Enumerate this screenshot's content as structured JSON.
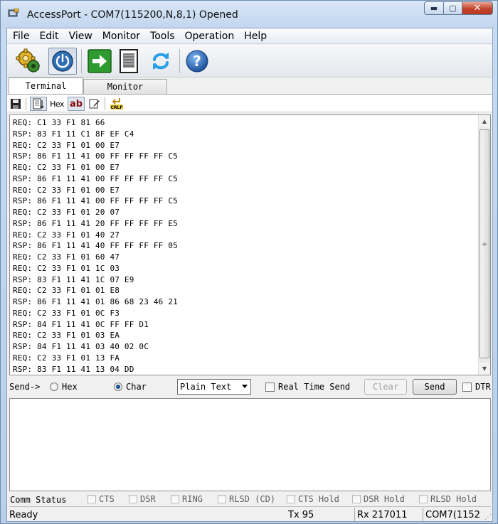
{
  "window": {
    "title": "AccessPort - COM7(115200,N,8,1) Opened",
    "minimize_glyph": "▬",
    "maximize_glyph": "▢",
    "close_glyph": "✕"
  },
  "menu": [
    "File",
    "Edit",
    "View",
    "Monitor",
    "Tools",
    "Operation",
    "Help"
  ],
  "toolbar": {
    "buttons": [
      "settings-gears-icon",
      "power-icon",
      "go-arrow-icon",
      "document-icon",
      "refresh-icon",
      "help-icon"
    ],
    "help_glyph": "?"
  },
  "tabs": {
    "active": "Terminal",
    "inactive": "Monitor"
  },
  "small_toolbar": {
    "hex_label": "Hex",
    "ab_label": "ab",
    "crlf_label": "CRLF"
  },
  "terminal": {
    "lines": [
      "REQ: C1 33 F1 81 66",
      "RSP: 83 F1 11 C1 8F EF C4",
      "REQ: C2 33 F1 01 00 E7",
      "RSP: 86 F1 11 41 00 FF FF FF FF C5",
      "REQ: C2 33 F1 01 00 E7",
      "RSP: 86 F1 11 41 00 FF FF FF FF C5",
      "REQ: C2 33 F1 01 00 E7",
      "RSP: 86 F1 11 41 00 FF FF FF FF C5",
      "REQ: C2 33 F1 01 20 07",
      "RSP: 86 F1 11 41 20 FF FF FF FF E5",
      "REQ: C2 33 F1 01 40 27",
      "RSP: 86 F1 11 41 40 FF FF FF FF 05",
      "REQ: C2 33 F1 01 60 47",
      "REQ: C2 33 F1 01 1C 03",
      "RSP: 83 F1 11 41 1C 07 E9",
      "REQ: C2 33 F1 01 01 E8",
      "RSP: 86 F1 11 41 01 86 68 23 46 21",
      "REQ: C2 33 F1 01 0C F3",
      "RSP: 84 F1 11 41 0C FF FF D1",
      "REQ: C2 33 F1 01 03 EA",
      "RSP: 84 F1 11 41 03 40 02 0C",
      "REQ: C2 33 F1 01 13 FA",
      "RSP: 83 F1 11 41 13 04 DD"
    ]
  },
  "send_bar": {
    "label": "Send->",
    "hex_option": "Hex",
    "char_option": "Char",
    "selected_option": "Char",
    "format_select": "Plain Text",
    "realtime_label": "Real Time Send",
    "clear_label": "Clear",
    "send_label": "Send",
    "dtr_label": "DTR"
  },
  "comm_status": {
    "label": "Comm Status",
    "flags": [
      "CTS",
      "DSR",
      "RING",
      "RLSD (CD)",
      "CTS Hold",
      "DSR Hold",
      "RLSD Hold"
    ]
  },
  "status_bar": {
    "state": "Ready",
    "tx": "Tx 95",
    "rx": "Rx 217011",
    "port": "COM7(1152"
  }
}
